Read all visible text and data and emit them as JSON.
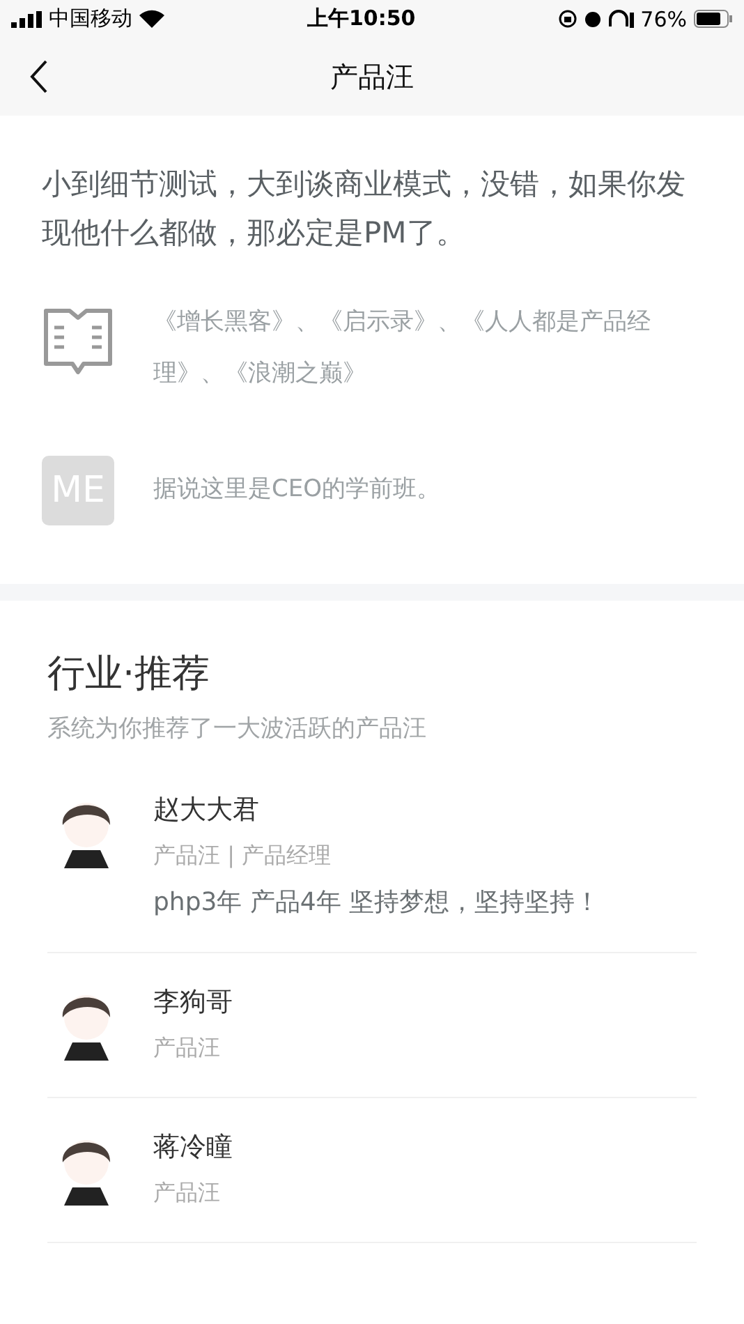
{
  "status_bar": {
    "carrier": "中国移动",
    "time": "上午10:50",
    "battery": "76%"
  },
  "nav": {
    "title": "产品汪"
  },
  "intro": {
    "description": "小到细节测试，大到谈商业模式，没错，如果你发现他什么都做，那必定是PM了。",
    "facts": [
      {
        "kind": "book",
        "text": "《增长黑客》、《启示录》、《人人都是产品经理》、《浪潮之巅》"
      },
      {
        "kind": "badge",
        "badge": "ME",
        "text": "据说这里是CEO的学前班。"
      }
    ]
  },
  "recommend": {
    "title": "行业·推荐",
    "subtitle": "系统为你推荐了一大波活跃的产品汪",
    "people": [
      {
        "name": "赵大大君",
        "tags": "产品汪 | 产品经理",
        "bio": "php3年 产品4年 坚持梦想，坚持坚持！"
      },
      {
        "name": "李狗哥",
        "tags": "产品汪"
      },
      {
        "name": "蒋冷瞳",
        "tags": "产品汪"
      }
    ]
  }
}
